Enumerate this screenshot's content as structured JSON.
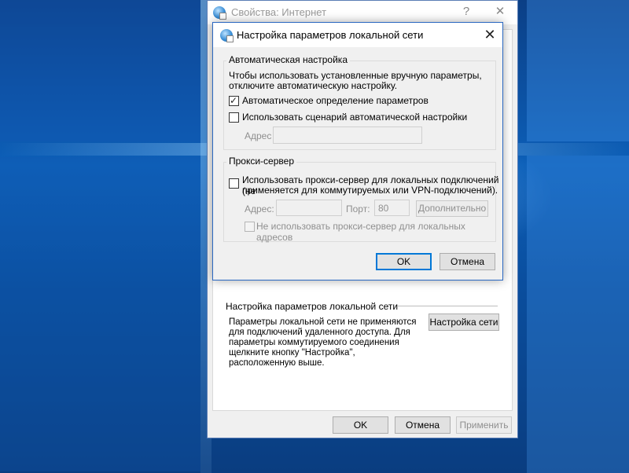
{
  "main_window": {
    "title": "Свойства: Интернет",
    "help_label": "?",
    "close_label": "✕",
    "lan_group": {
      "title": "Настройка параметров локальной сети",
      "description": "Параметры локальной сети не применяются\nдля подключений удаленного доступа. Для\nпараметры коммутируемого соединения\nщелкните кнопку \"Настройка\",\nрасположенную выше.",
      "button_label": "Настройка сети"
    },
    "buttons": {
      "ok": "OK",
      "cancel": "Отмена",
      "apply": "Применить"
    }
  },
  "lan_dialog": {
    "title": "Настройка параметров локальной сети",
    "close_label": "✕",
    "auto_config": {
      "title": "Автоматическая настройка",
      "description_line1": "Чтобы использовать установленные вручную параметры,",
      "description_line2": "отключите автоматическую настройку.",
      "auto_detect_label": "Автоматическое определение параметров",
      "auto_detect_checked": true,
      "script_label": "Использовать сценарий автоматической настройки",
      "script_checked": false,
      "address_label": "Адрес",
      "address_value": ""
    },
    "proxy": {
      "title": "Прокси-сервер",
      "use_proxy_label_line1": "Использовать прокси-сервер для локальных подключений (не",
      "use_proxy_label_line2": "применяется для коммутируемых или VPN-подключений).",
      "use_proxy_checked": false,
      "address_label": "Адрес:",
      "address_value": "",
      "port_label": "Порт:",
      "port_value": "80",
      "advanced_label": "Дополнительно",
      "bypass_label": "Не использовать прокси-сервер для локальных адресов",
      "bypass_checked": false
    },
    "buttons": {
      "ok": "OK",
      "cancel": "Отмена"
    }
  }
}
